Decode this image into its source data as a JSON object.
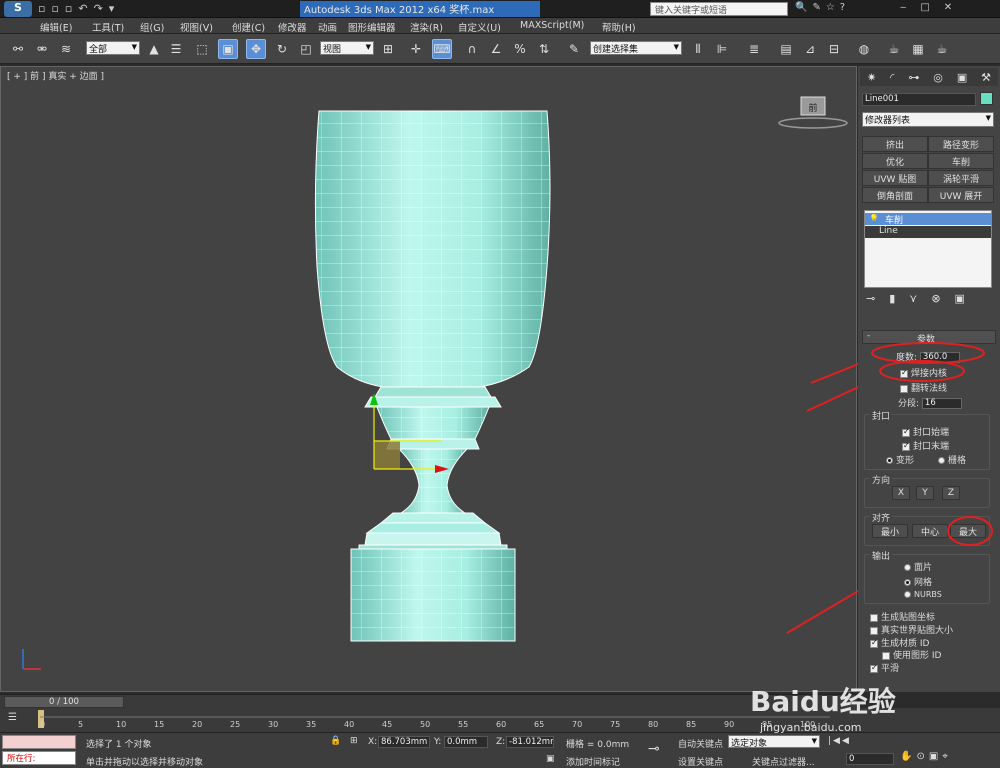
{
  "titlebar": {
    "title": "Autodesk 3ds Max  2012  x64    奖杯.max",
    "search_placeholder": "键入关键字或短语"
  },
  "menubar": {
    "items": [
      "编辑(E)",
      "工具(T)",
      "组(G)",
      "视图(V)",
      "创建(C)",
      "修改器",
      "动画",
      "图形编辑器",
      "渲染(R)",
      "自定义(U)",
      "MAXScript(M)",
      "帮助(H)"
    ]
  },
  "toolbar": {
    "selection_filter": "全部",
    "ref_coord": "视图",
    "named_selection": "创建选择集"
  },
  "viewport": {
    "label": "[ + ] 前 ] 真实 + 边面 ]",
    "viewcube_label": "前"
  },
  "panel": {
    "object_name": "Line001",
    "modifier_list": "修改器列表",
    "buttons": [
      "挤出",
      "路径变形",
      "优化",
      "车削",
      "UVW 贴图",
      "涡轮平滑",
      "倒角剖面",
      "UVW 展开"
    ],
    "stack": [
      "车削",
      "Line"
    ],
    "params_title": "参数",
    "degrees_label": "度数:",
    "degrees_value": "360.0",
    "weld_core": "焊接内核",
    "flip_normals": "翻转法线",
    "segments_label": "分段:",
    "segments_value": "16",
    "capping_title": "封口",
    "cap_start": "封口始端",
    "cap_end": "封口末端",
    "morph": "变形",
    "grid": "栅格",
    "direction_title": "方向",
    "dir_x": "X",
    "dir_y": "Y",
    "dir_z": "Z",
    "align_title": "对齐",
    "align_min": "最小",
    "align_center": "中心",
    "align_max": "最大",
    "output_title": "输出",
    "out_patch": "面片",
    "out_mesh": "网格",
    "out_nurbs": "NURBS",
    "gen_map": "生成贴图坐标",
    "real_world": "真实世界贴图大小",
    "gen_mat": "生成材质 ID",
    "use_shape": "使用图形 ID",
    "smooth": "平滑"
  },
  "timeline": {
    "slider": "0 / 100",
    "ticks": [
      "0",
      "5",
      "10",
      "15",
      "20",
      "25",
      "30",
      "35",
      "40",
      "45",
      "50",
      "55",
      "60",
      "65",
      "70",
      "75",
      "80",
      "85",
      "90",
      "95",
      "100"
    ]
  },
  "status": {
    "current": "所在行:",
    "selected": "选择了 1 个对象",
    "prompt": "单击并拖动以选择并移动对象",
    "x_label": "X:",
    "x_value": "86.703mm",
    "y_label": "Y:",
    "y_value": "0.0mm",
    "z_label": "Z:",
    "z_value": "-81.012mm",
    "grid": "栅格 = 0.0mm",
    "add_time_tag": "添加时间标记",
    "auto_key": "自动关键点",
    "set_key": "设置关键点",
    "key_mode": "选定对象",
    "key_filters": "关键点过滤器...",
    "frame": "0"
  },
  "watermark": {
    "brand": "Baidu经验",
    "url": "jingyan.baidu.com"
  },
  "colors": {
    "model": "#a8eee2",
    "accent": "#5a8fd6",
    "annotation": "#e02020"
  }
}
